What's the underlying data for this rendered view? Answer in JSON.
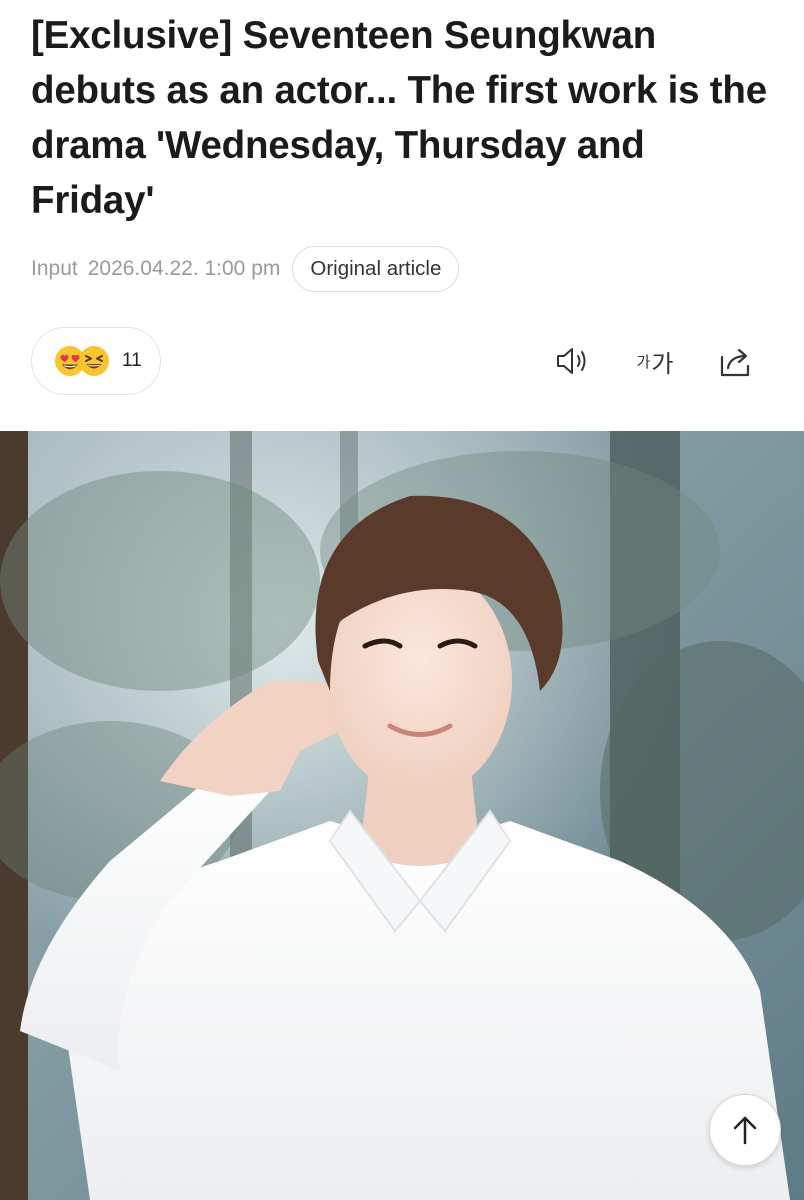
{
  "article": {
    "headline": "[Exclusive] Seventeen Seungkwan debuts as an actor... The first work is the drama 'Wednesday, Thursday and Friday'",
    "input_label": "Input",
    "input_date": "2026.04.22. 1:00 pm",
    "original_article_label": "Original article"
  },
  "reactions": {
    "count": "11",
    "icons": [
      "heart-eyes-emoji-icon",
      "grinning-squint-emoji-icon"
    ]
  },
  "toolbar": {
    "tts_icon": "speaker-icon",
    "font_small": "가",
    "font_large": "가",
    "share_icon": "share-icon"
  },
  "photo": {
    "subject": "article-photo"
  },
  "colors": {
    "meta_text": "#9a9a9a",
    "border": "#dedede",
    "emoji_yellow": "#f7c531",
    "emoji_heart": "#e8334a"
  }
}
